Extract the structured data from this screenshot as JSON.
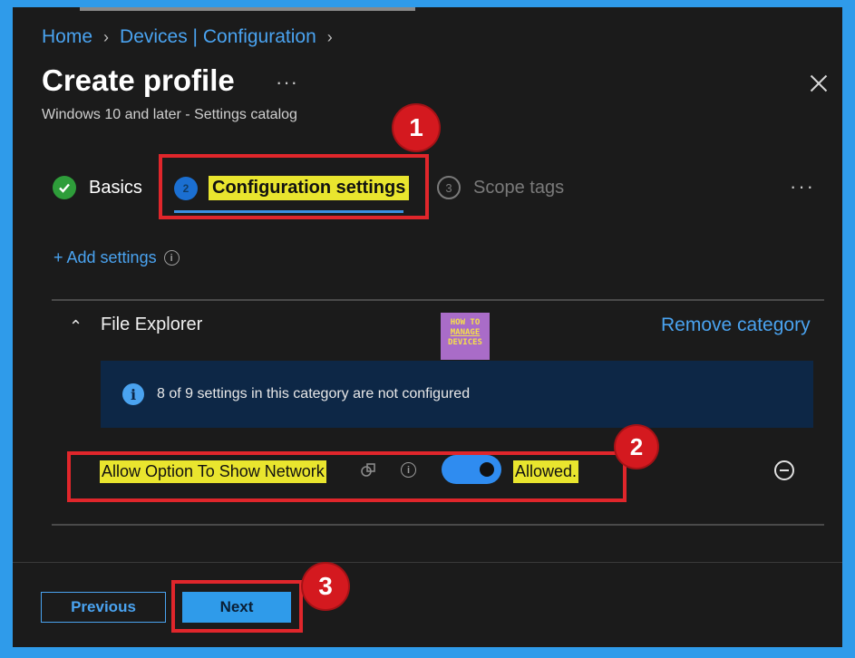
{
  "breadcrumb": {
    "home": "Home",
    "devices": "Devices | Configuration"
  },
  "page": {
    "title": "Create profile",
    "subtitle": "Windows 10 and later - Settings catalog"
  },
  "tabs": [
    {
      "label": "Basics",
      "state": "completed"
    },
    {
      "number": "2",
      "label": "Configuration settings",
      "state": "active"
    },
    {
      "number": "3",
      "label": "Scope tags",
      "state": "pending"
    }
  ],
  "add_settings": {
    "label": "+ Add settings"
  },
  "category": {
    "title": "File Explorer",
    "remove_label": "Remove category",
    "banner_text": "8 of 9 settings in this category are not configured"
  },
  "setting": {
    "name": "Allow Option To Show Network",
    "value_label": "Allowed."
  },
  "logo": {
    "line1": "HOW TO",
    "line2": "MANAGE",
    "line3": "DEVICES"
  },
  "callouts": [
    "1",
    "2",
    "3"
  ],
  "footer": {
    "previous": "Previous",
    "next": "Next"
  },
  "colors": {
    "accent": "#4aa3f0",
    "highlight": "#e9e52e",
    "callout": "#d4191f",
    "frame": "#2f9bea"
  }
}
